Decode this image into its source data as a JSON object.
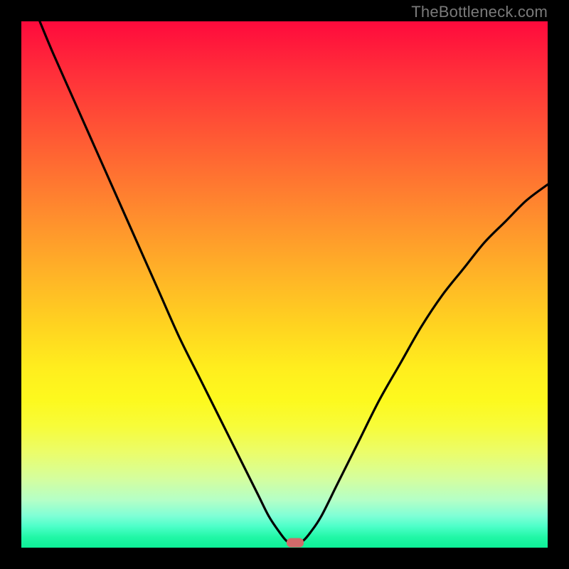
{
  "watermark": "TheBottleneck.com",
  "colors": {
    "frame_bg": "#000000",
    "curve": "#000000",
    "marker": "#d16a6a",
    "gradient_stops": [
      "#ff0a3c",
      "#ff2f3a",
      "#ff5934",
      "#ff8a2e",
      "#ffb327",
      "#ffd420",
      "#ffee1e",
      "#fdf91e",
      "#f7fc3a",
      "#ebfd6b",
      "#d4fe9f",
      "#b4ffc7",
      "#7effd6",
      "#4cffc8",
      "#21f7a6",
      "#0df097"
    ]
  },
  "chart_data": {
    "type": "line",
    "title": "",
    "xlabel": "",
    "ylabel": "",
    "xlim": [
      0,
      100
    ],
    "ylim": [
      0,
      100
    ],
    "grid": false,
    "legend": false,
    "note": "Values are percent of plot area. y=0 at bottom, y=100 at top. Approximate readings from the figure.",
    "series": [
      {
        "name": "curve",
        "points": [
          {
            "x": 3.5,
            "y": 100
          },
          {
            "x": 6,
            "y": 94
          },
          {
            "x": 10,
            "y": 85
          },
          {
            "x": 14,
            "y": 76
          },
          {
            "x": 18,
            "y": 67
          },
          {
            "x": 22,
            "y": 58
          },
          {
            "x": 26,
            "y": 49
          },
          {
            "x": 30,
            "y": 40
          },
          {
            "x": 34,
            "y": 32
          },
          {
            "x": 38,
            "y": 24
          },
          {
            "x": 42,
            "y": 16
          },
          {
            "x": 45,
            "y": 10
          },
          {
            "x": 47,
            "y": 6
          },
          {
            "x": 49,
            "y": 3
          },
          {
            "x": 50.5,
            "y": 1.2
          },
          {
            "x": 52,
            "y": 1.0
          },
          {
            "x": 53.5,
            "y": 1.3
          },
          {
            "x": 55,
            "y": 3
          },
          {
            "x": 57,
            "y": 6
          },
          {
            "x": 60,
            "y": 12
          },
          {
            "x": 64,
            "y": 20
          },
          {
            "x": 68,
            "y": 28
          },
          {
            "x": 72,
            "y": 35
          },
          {
            "x": 76,
            "y": 42
          },
          {
            "x": 80,
            "y": 48
          },
          {
            "x": 84,
            "y": 53
          },
          {
            "x": 88,
            "y": 58
          },
          {
            "x": 92,
            "y": 62
          },
          {
            "x": 96,
            "y": 66
          },
          {
            "x": 100,
            "y": 69
          }
        ]
      }
    ],
    "marker": {
      "x": 52,
      "y": 1.0
    }
  }
}
